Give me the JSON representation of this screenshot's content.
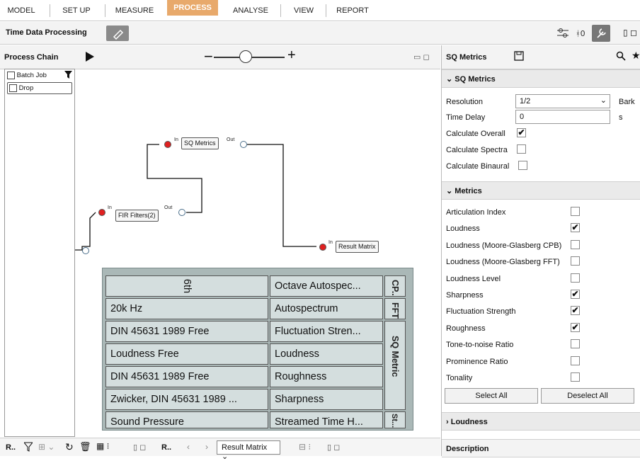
{
  "menu": {
    "model": "MODEL",
    "setup": "SET UP",
    "measure": "MEASURE",
    "process": "PROCESS",
    "analyse": "ANALYSE",
    "view": "VIEW",
    "report": "REPORT"
  },
  "toolbar": {
    "title": "Time Data Processing"
  },
  "process_chain": {
    "title": "Process Chain",
    "batch_job": "Batch Job",
    "drop": "Drop",
    "zoom_minus": "−",
    "zoom_plus": "+"
  },
  "nodes": {
    "sq_metrics": "SQ Metrics",
    "fir_filters": "FIR Filters(2)",
    "result_matrix": "Result Matrix",
    "in": "In",
    "out": "Out"
  },
  "table": {
    "rows": [
      {
        "c1": "6th",
        "c2": "Octave Autospec..."
      },
      {
        "c1": "20k Hz",
        "c2": "Autospectrum"
      },
      {
        "c1": "DIN 45631 1989 Free",
        "c2": "Fluctuation Stren..."
      },
      {
        "c1": "Loudness Free",
        "c2": "Loudness"
      },
      {
        "c1": "DIN 45631 1989 Free",
        "c2": "Roughness"
      },
      {
        "c1": "Zwicker, DIN 45631 1989 ...",
        "c2": "Sharpness"
      },
      {
        "c1": "Sound Pressure",
        "c2": "Streamed Time H..."
      }
    ],
    "groups": {
      "cp": "CP..",
      "fft": "FFT",
      "sq": "SQ Metric",
      "st": "St..."
    }
  },
  "right": {
    "title": "SQ Metrics",
    "sec1": "SQ Metrics",
    "resolution_label": "Resolution",
    "resolution_value": "1/2",
    "resolution_unit": "Bark",
    "delay_label": "Time Delay",
    "delay_value": "0",
    "delay_unit": "s",
    "calc_overall": "Calculate Overall",
    "calc_spectra": "Calculate Spectra",
    "calc_binaural": "Calculate Binaural",
    "sec2": "Metrics",
    "metrics": [
      {
        "label": "Articulation Index",
        "checked": ""
      },
      {
        "label": "Loudness",
        "checked": "✔"
      },
      {
        "label": "Loudness (Moore-Glasberg CPB)",
        "checked": ""
      },
      {
        "label": "Loudness (Moore-Glasberg FFT)",
        "checked": ""
      },
      {
        "label": "Loudness Level",
        "checked": ""
      },
      {
        "label": "Sharpness",
        "checked": "✔"
      },
      {
        "label": "Fluctuation Strength",
        "checked": "✔"
      },
      {
        "label": "Roughness",
        "checked": "✔"
      },
      {
        "label": "Tone-to-noise Ratio",
        "checked": ""
      },
      {
        "label": "Prominence Ratio",
        "checked": ""
      },
      {
        "label": "Tonality",
        "checked": ""
      }
    ],
    "select_all": "Select All",
    "deselect_all": "Deselect All",
    "sec3": "Loudness",
    "description": "Description",
    "overall_check": "✔"
  },
  "bottom": {
    "r1": "R..",
    "r2": "R..",
    "result_matrix": "Result Matrix"
  }
}
